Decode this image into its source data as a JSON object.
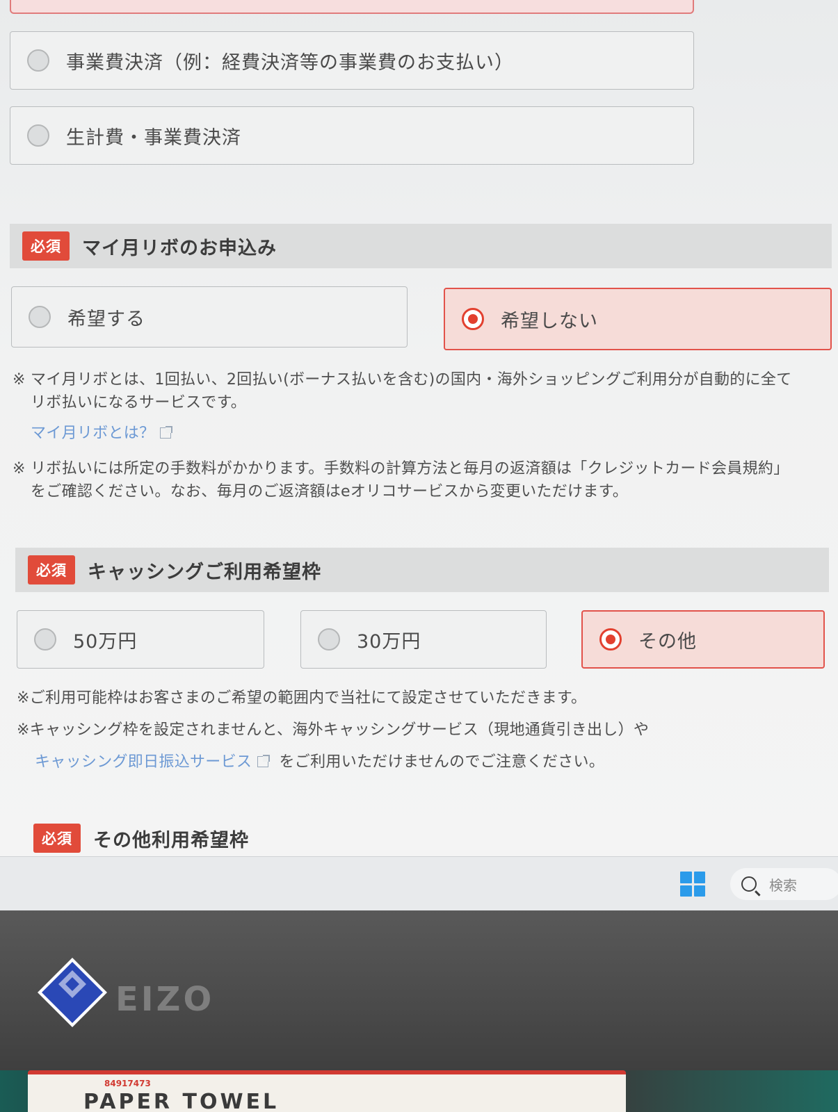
{
  "purpose_options": [
    {
      "label": "事業費決済（例：経費決済等の事業費のお支払い）",
      "selected": false
    },
    {
      "label": "生計費・事業費決済",
      "selected": false
    }
  ],
  "revolving": {
    "badge": "必須",
    "title": "マイ月リボのお申込み",
    "options": [
      {
        "label": "希望する",
        "selected": false
      },
      {
        "label": "希望しない",
        "selected": true
      }
    ],
    "note1_mark": "※",
    "note1_line1": "マイ月リボとは、1回払い、2回払い(ボーナス払いを含む)の国内・海外ショッピングご利用分が自動的に全て",
    "note1_line2": "リボ払いになるサービスです。",
    "link": "マイ月リボとは？",
    "note2_mark": "※",
    "note2_line1": "リボ払いには所定の手数料がかかります。手数料の計算方法と毎月の返済額は「クレジットカード会員規約」",
    "note2_line2": "をご確認ください。なお、毎月のご返済額はeオリコサービスから変更いただけます。"
  },
  "cashing": {
    "badge": "必須",
    "title": "キャッシングご利用希望枠",
    "options": [
      {
        "label": "50万円",
        "selected": false
      },
      {
        "label": "30万円",
        "selected": false
      },
      {
        "label": "その他",
        "selected": true
      }
    ],
    "note1": "※ご利用可能枠はお客さまのご希望の範囲内で当社にて設定させていただきます。",
    "note2": "※キャッシング枠を設定されませんと、海外キャッシングサービス（現地通貨引き出し）や",
    "link": "キャッシング即日振込サービス",
    "note3": "をご利用いただけませんのでご注意ください。"
  },
  "other_limit": {
    "badge": "必須",
    "title": "その他利用希望枠"
  },
  "taskbar": {
    "search_placeholder": "検索"
  },
  "monitor": {
    "brand": "EIZO"
  },
  "desk": {
    "towel_code": "84917473",
    "towel_text": "PAPER TOWEL"
  },
  "colors": {
    "accent_red": "#e2402f",
    "badge_red": "#e14b3a",
    "link_blue": "#6c99d4",
    "windows_blue": "#2b9bea"
  }
}
